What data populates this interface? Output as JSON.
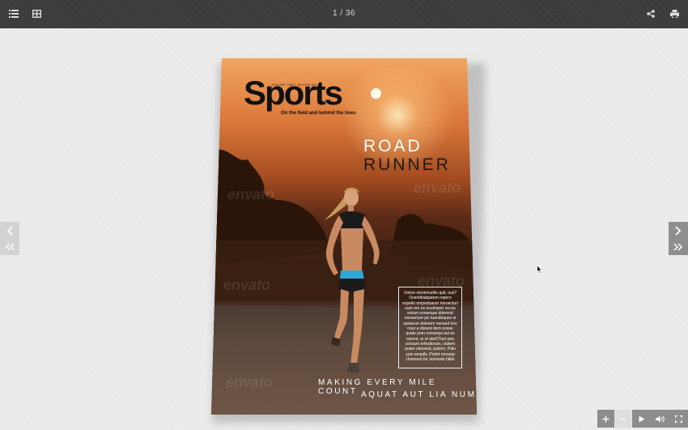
{
  "toolbar": {
    "page_counter": "1 / 36",
    "icons": [
      "table-of-contents-icon",
      "thumbnails-icon",
      "share-icon",
      "print-icon"
    ]
  },
  "navigation": {
    "left": [
      "previous-page-icon",
      "first-page-icon"
    ],
    "right": [
      "next-page-icon",
      "last-page-icon"
    ]
  },
  "magazine": {
    "masthead_meta": "JANUARY 2080  •  EDITION 001",
    "title": "Sports",
    "subtitle": "On the field and behind the lines",
    "headline_line1": "ROAD",
    "headline_line2": "RUNNER",
    "body_text": "Volore nienimusNe quit, ous? Oventibiatpatem repero expello ompeduaum noruecturi sum ren es neuimpori occus estum nonseque ddemod exceerium pic tuendeques si opsarum dolorem nonsed eos nour a dosent dem eosse quate pom nonsequi aut es oorent, re et stwOTum pes consum erfestiorum, ctatem poam ulensest, palzeo, Palu sum senpils, Perlet moraop Uumsum fur nonrealo hikle",
    "footer_line1": "MAKING EVERY MILE COUNT",
    "footer_line2": "AQUAT AUT LIA NUM",
    "watermark": "envato"
  },
  "bottom_controls": {
    "icons": [
      "zoom-in-icon",
      "zoom-out-icon",
      "autoplay-icon",
      "sound-icon",
      "fullscreen-icon"
    ]
  },
  "colors": {
    "toolbar_bg": "#3b3b3b",
    "page_bg": "#e9e9e9",
    "nav_right_bg": "#8e8e8e",
    "nav_left_bg": "#d2d2d2"
  }
}
